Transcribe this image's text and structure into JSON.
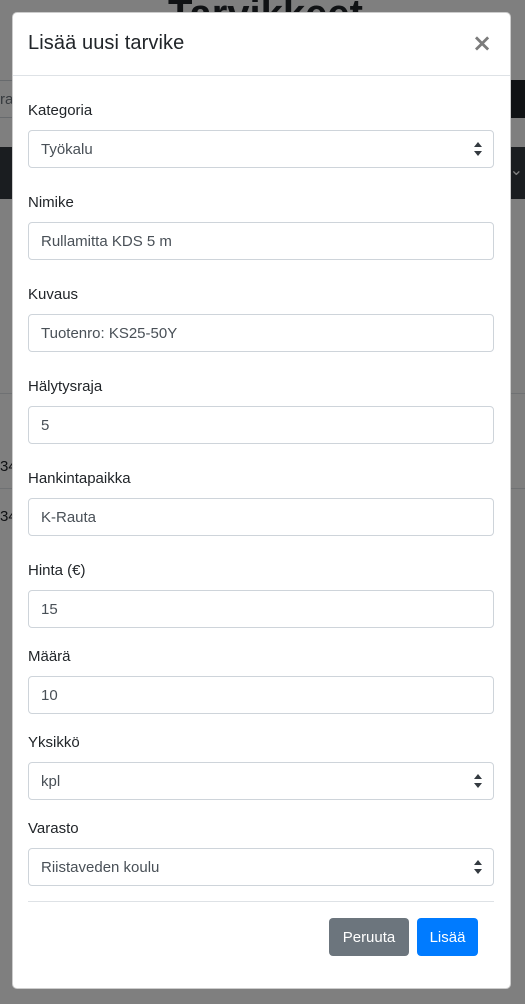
{
  "background": {
    "heading": "Tarvikkeet",
    "search_fragment": "ra",
    "row_fragments": [
      "34",
      "34"
    ]
  },
  "modal": {
    "title": "Lisää uusi tarvike",
    "close_symbol": "×"
  },
  "form": {
    "category": {
      "label": "Kategoria",
      "value": "Työkalu"
    },
    "name": {
      "label": "Nimike",
      "value": "Rullamitta KDS 5 m"
    },
    "description": {
      "label": "Kuvaus",
      "value": "Tuotenro: KS25-50Y"
    },
    "alert_limit": {
      "label": "Hälytysraja",
      "value": "5"
    },
    "supplier": {
      "label": "Hankintapaikka",
      "value": "K-Rauta"
    },
    "price": {
      "label": "Hinta (€)",
      "value": "15"
    },
    "quantity": {
      "label": "Määrä",
      "value": "10"
    },
    "unit": {
      "label": "Yksikkö",
      "value": "kpl"
    },
    "warehouse": {
      "label": "Varasto",
      "value": "Riistaveden koulu"
    }
  },
  "footer": {
    "cancel_label": "Peruuta",
    "add_label": "Lisää"
  },
  "colors": {
    "primary": "#007bff",
    "secondary": "#6c757d",
    "navbar": "#343a40"
  }
}
